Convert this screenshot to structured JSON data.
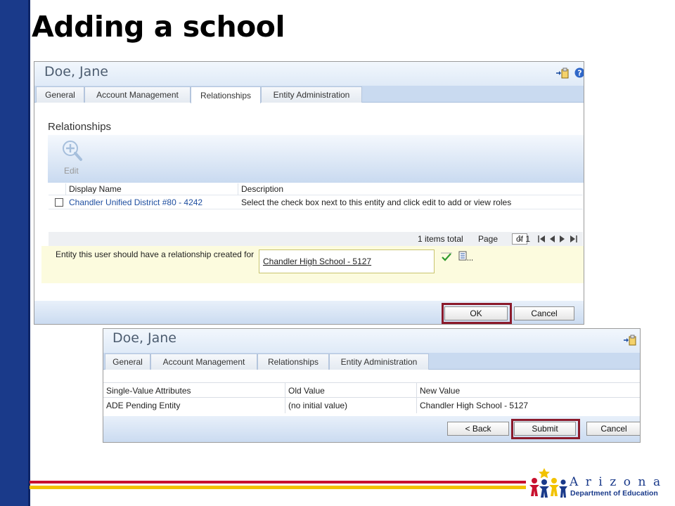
{
  "slide": {
    "title": "Adding a school"
  },
  "logo": {
    "word": "Arizona",
    "subtitle": "Department of Education"
  },
  "window1": {
    "title": "Doe, Jane",
    "tabs": [
      {
        "label": "General"
      },
      {
        "label": "Account Management"
      },
      {
        "label": "Relationships"
      },
      {
        "label": "Entity Administration"
      }
    ],
    "active_tab": "Relationships",
    "section_heading": "Relationships",
    "toolbar": {
      "edit_label": "Edit"
    },
    "grid": {
      "columns": [
        "Display Name",
        "Description"
      ],
      "rows": [
        {
          "display_name": "Chandler Unified District #80 - 4242",
          "description": "Select the check box next to this entity and click edit to add or view roles"
        }
      ]
    },
    "pager": {
      "total": "1 items total",
      "page_label": "Page",
      "page_value": "1",
      "of_label": "of 1"
    },
    "entity": {
      "label": "Entity this user should have a relationship created for",
      "value": "Chandler High School - 5127"
    },
    "buttons": {
      "ok": "OK",
      "cancel": "Cancel"
    }
  },
  "window2": {
    "title": "Doe, Jane",
    "tabs": [
      {
        "label": "General"
      },
      {
        "label": "Account Management"
      },
      {
        "label": "Relationships"
      },
      {
        "label": "Entity Administration"
      }
    ],
    "grid": {
      "columns": [
        "Single-Value Attributes",
        "Old Value",
        "New Value"
      ],
      "rows": [
        {
          "attribute": "ADE Pending Entity",
          "old_value": "(no initial value)",
          "new_value": "Chandler High School - 5127"
        }
      ]
    },
    "buttons": {
      "back": "< Back",
      "submit": "Submit",
      "cancel": "Cancel"
    }
  },
  "colors": {
    "side_bar": "#1a3a8a",
    "highlight": "#8b1a2b",
    "stripe_red": "#c8102e",
    "stripe_yellow": "#f2c200"
  }
}
